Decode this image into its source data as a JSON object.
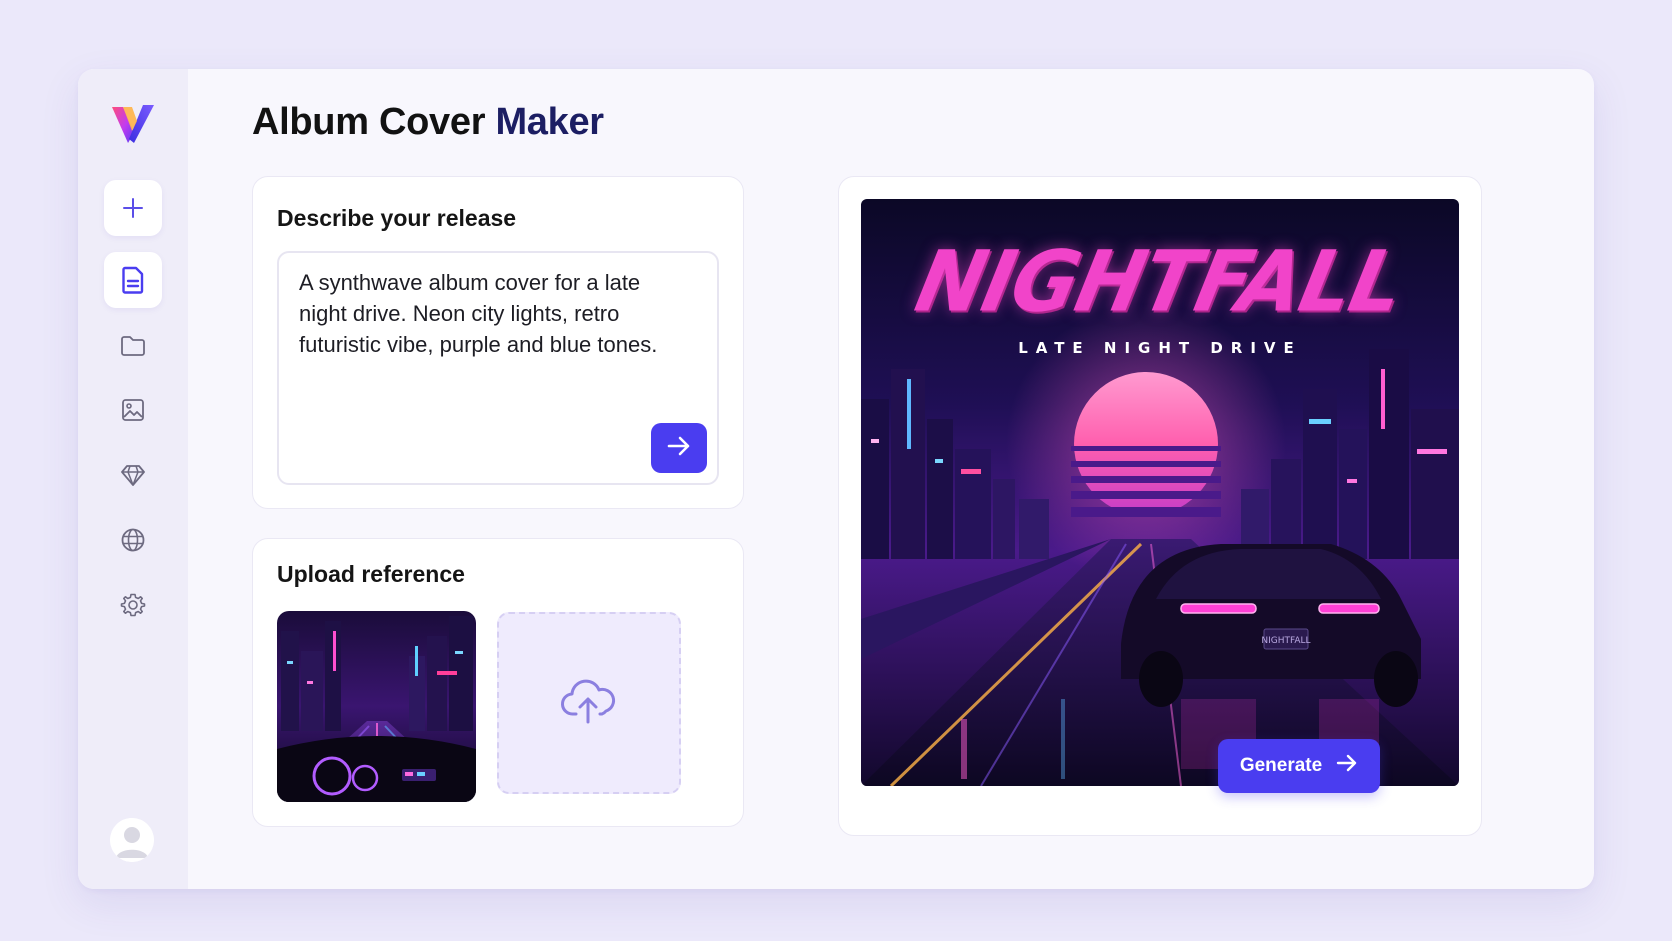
{
  "app": {
    "title_part1": "Album Cover",
    "title_part2": "Maker",
    "brand_color": "#4a3df0"
  },
  "sidebar": {
    "logo_icon": "v-logo-icon",
    "items": [
      {
        "name": "new",
        "icon": "plus-icon",
        "selected": false
      },
      {
        "name": "document",
        "icon": "document-icon",
        "selected": true
      },
      {
        "name": "folder",
        "icon": "folder-icon",
        "selected": false
      },
      {
        "name": "gallery",
        "icon": "image-icon",
        "selected": false
      },
      {
        "name": "premium",
        "icon": "diamond-icon",
        "selected": false
      },
      {
        "name": "explore",
        "icon": "globe-icon",
        "selected": false
      },
      {
        "name": "settings",
        "icon": "gear-icon",
        "selected": false
      }
    ],
    "user_icon": "avatar-icon"
  },
  "describe": {
    "title": "Describe your release",
    "prompt": "A synthwave album cover for a late night drive. Neon city lights, retro futuristic vibe, purple and blue tones.",
    "send_icon": "arrow-right-icon"
  },
  "upload": {
    "title": "Upload reference",
    "upload_icon": "cloud-upload-icon"
  },
  "preview": {
    "cover_title": "NIGHTFALL",
    "cover_subtitle": "LATE NIGHT DRIVE",
    "plate_text": "NIGHTFALL"
  },
  "actions": {
    "generate_label": "Generate",
    "generate_icon": "arrow-right-icon"
  }
}
